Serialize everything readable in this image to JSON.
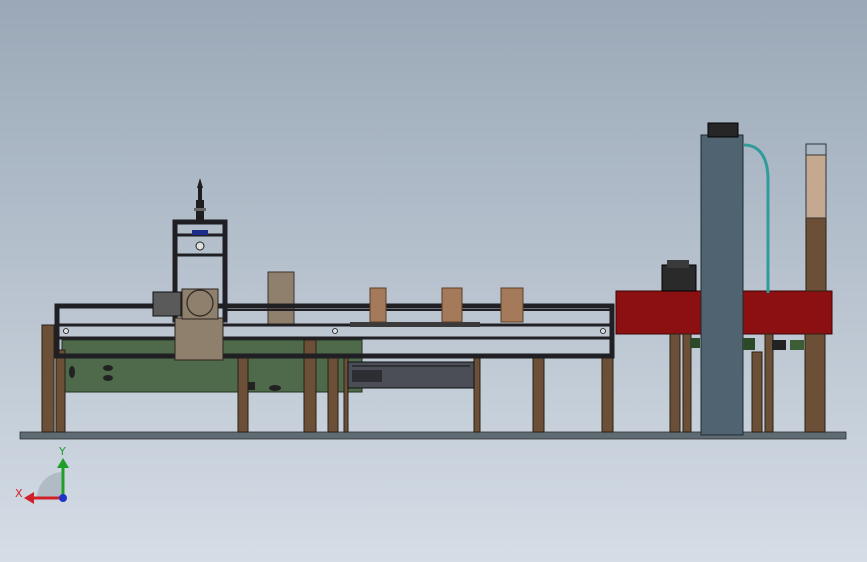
{
  "viewport": {
    "background_top": "#9aa8b7",
    "background_bottom": "#d5dde6",
    "projection": "front view"
  },
  "colors": {
    "frame_black": "#1f1f24",
    "post_brown": "#6b4f36",
    "plate_green": "#4e6a4a",
    "panel_red": "#8c0f12",
    "column_slate": "#4f6470",
    "wood_tan": "#a57a5a",
    "base_gray": "#5f6b73",
    "tube_teal": "#2f9c9a",
    "block_taupe": "#8f7f6d"
  },
  "triad": {
    "x_label": "X",
    "y_label": "Y",
    "x_color": "#d0202a",
    "y_color": "#1f9e2b",
    "z_color": "#1f33c8",
    "x_icon": "arrow-left-icon",
    "y_icon": "arrow-up-icon",
    "z_icon": "dot-icon"
  }
}
